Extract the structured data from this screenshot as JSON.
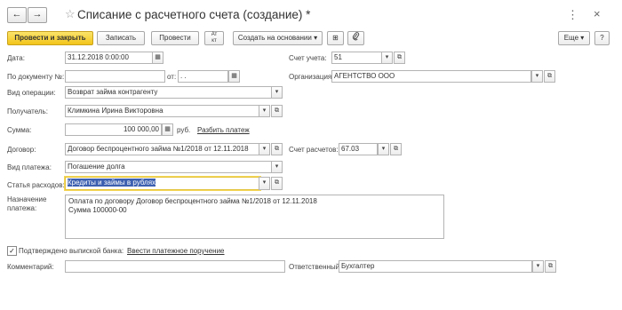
{
  "window": {
    "back": "←",
    "forward": "→",
    "favorite": "☆",
    "title": "Списание с расчетного счета (создание) *",
    "more": "⋮",
    "close": "×"
  },
  "toolbar": {
    "post_close": "Провести и закрыть",
    "save": "Записать",
    "post": "Провести",
    "dt_kt": "Ат\nкт",
    "create_based": "Создать на основании ▾",
    "more": "Еще ▾",
    "help": "?"
  },
  "form": {
    "date_label": "Дата:",
    "date_value": "31.12.2018  0:00:00",
    "account_label": "Счет учета:",
    "account_value": "51",
    "docnum_label": "По документу №:",
    "docnum_value": "",
    "from_label": "от:",
    "from_value": " .  .",
    "org_label": "Организация:",
    "org_value": "АГЕНТСТВО ООО",
    "op_label": "Вид операции:",
    "op_value": "Возврат займа контрагенту",
    "payee_label": "Получатель:",
    "payee_value": "Климкина Ирина Викторовна",
    "sum_label": "Сумма:",
    "sum_value": "100 000,00",
    "currency": "руб.",
    "split_link": "Разбить платеж",
    "contract_label": "Договор:",
    "contract_value": "Договор беспроцентного займа №1/2018 от 12.11.2018",
    "settle_label": "Счет расчетов:",
    "settle_value": "67.03",
    "paytype_label": "Вид платежа:",
    "paytype_value": "Погашение долга",
    "expense_label": "Статья расходов:",
    "expense_value": "Кредиты и займы в рублях",
    "purpose_label_1": "Назначение",
    "purpose_label_2": "платежа:",
    "purpose_line_1": "Оплата по договору Договор беспроцентного займа №1/2018 от 12.11.2018",
    "purpose_line_2": "Сумма 100000-00",
    "confirmed_label": "Подтверждено выпиской банка:",
    "confirmed_checked": "✓",
    "enter_order_link": "Ввести платежное поручение",
    "comment_label": "Комментарий:",
    "comment_value": "",
    "responsible_label": "Ответственный:",
    "responsible_value": "Бухгалтер"
  },
  "icons": {
    "calendar": "▦",
    "dropdown": "▾",
    "open": "⧉",
    "ellipsis": "…",
    "stepper_up": "▴",
    "stepper_down": "▾",
    "structure": "⊞",
    "attach": "🔗"
  }
}
